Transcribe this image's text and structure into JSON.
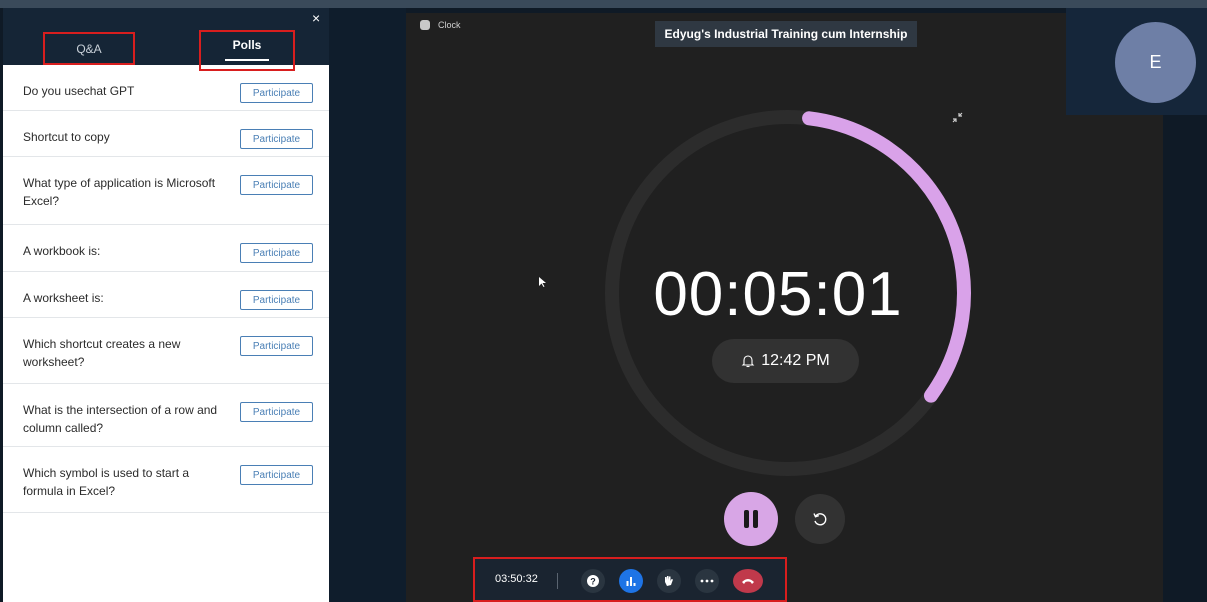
{
  "side_panel": {
    "close_label": "×",
    "tabs": [
      {
        "label": "Q&A",
        "active": false
      },
      {
        "label": "Polls",
        "active": true
      }
    ],
    "polls": [
      {
        "question": "Do you usechat GPT",
        "action": "Participate"
      },
      {
        "question": "Shortcut to copy",
        "action": "Participate"
      },
      {
        "question": "What type of application is Microsoft Excel?",
        "action": "Participate"
      },
      {
        "question": "A workbook is:",
        "action": "Participate"
      },
      {
        "question": "A worksheet is:",
        "action": "Participate"
      },
      {
        "question": "Which shortcut creates a new worksheet?",
        "action": "Participate"
      },
      {
        "question": "What is the intersection of a row and column called?",
        "action": "Participate"
      },
      {
        "question": "Which symbol is used to start a formula in Excel?",
        "action": "Participate"
      }
    ]
  },
  "stage": {
    "app_name": "Clock",
    "meeting_title": "Edyug's Industrial Training cum Internship",
    "avatar_initial": "E",
    "timer": {
      "remaining": "00:05:01",
      "alarm_time": "12:42 PM",
      "progress_fraction": 0.33
    }
  },
  "call_toolbar": {
    "elapsed": "03:50:32",
    "buttons": [
      {
        "name": "help",
        "icon": "question-icon",
        "color": "#2a3540"
      },
      {
        "name": "polls",
        "icon": "bar-chart-icon",
        "color": "#1e74e6"
      },
      {
        "name": "reactions",
        "icon": "hand-raise-icon",
        "color": "#2a3540"
      },
      {
        "name": "more",
        "icon": "more-icon",
        "color": "#2a3540"
      },
      {
        "name": "leave",
        "icon": "end-call-icon",
        "color": "#c0394b"
      }
    ]
  },
  "colors": {
    "accent_ring": "#d9a2e9",
    "ring_track": "#2c2c2c",
    "highlight_box": "#d81e1e"
  }
}
